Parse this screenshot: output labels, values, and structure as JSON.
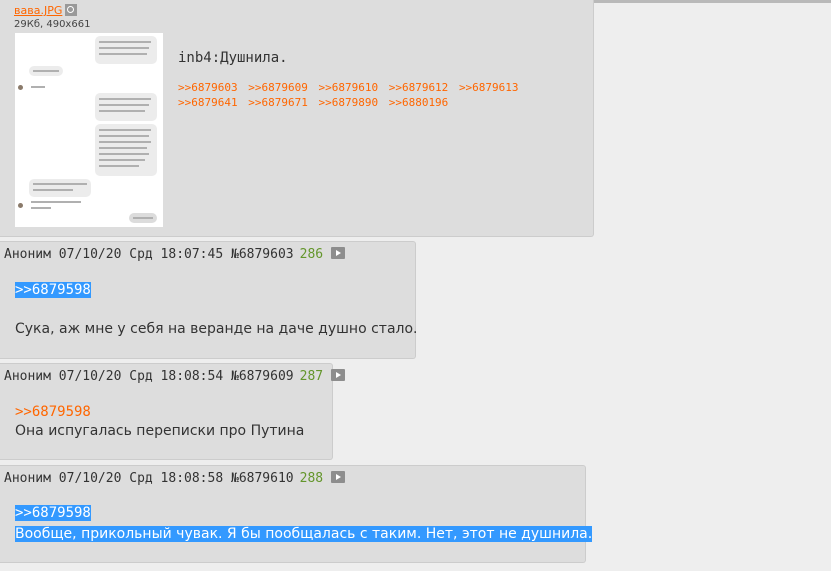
{
  "op": {
    "file_name": "вава.JPG",
    "file_info": "29Кб, 490x661",
    "text": "inb4:Душнила.",
    "replies": [
      ">>6879603",
      ">>6879609",
      ">>6879610",
      ">>6879612",
      ">>6879613",
      ">>6879641",
      ">>6879671",
      ">>6879890",
      ">>6880196"
    ]
  },
  "posts": [
    {
      "author": "Аноним",
      "date": "07/10/20 Срд 18:07:45",
      "id": "№6879603",
      "index": "286",
      "quote": ">>6879598",
      "text": "Сука, аж мне у себя на веранде на даче душно стало."
    },
    {
      "author": "Аноним",
      "date": "07/10/20 Срд 18:08:54",
      "id": "№6879609",
      "index": "287",
      "quote": ">>6879598",
      "text": "Она испугалась переписки про Путина"
    },
    {
      "author": "Аноним",
      "date": "07/10/20 Срд 18:08:58",
      "id": "№6879610",
      "index": "288",
      "quote": ">>6879598",
      "text": "Вообще, прикольный чувак. Я бы пообщалась с таким. Нет, этот не душнила."
    }
  ],
  "colors": {
    "link": "#ff6600",
    "post_bg": "#dddddd",
    "page_bg": "#eeeeee",
    "selection": "#3399ff",
    "post_number": "#64962c"
  },
  "icons": {
    "file_search": "magnifier-icon",
    "post_menu": "play-triangle-icon"
  }
}
